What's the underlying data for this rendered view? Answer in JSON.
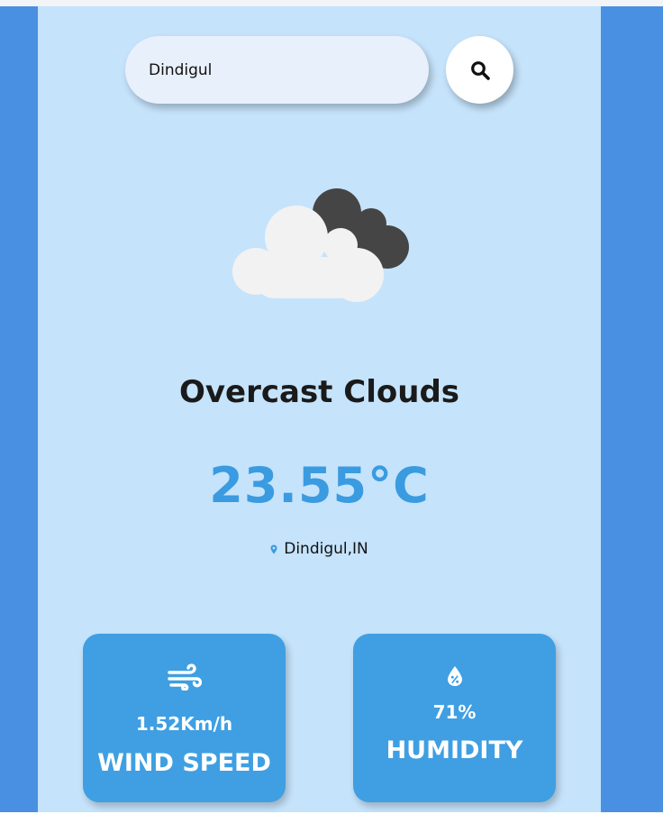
{
  "search": {
    "value": "Dindigul",
    "button_icon": "search-icon"
  },
  "weather": {
    "icon": "overcast-clouds-icon",
    "condition": "Overcast Clouds",
    "temperature": "23.55°C",
    "location": "Dindigul,IN",
    "location_icon": "map-pin-icon"
  },
  "cards": {
    "wind": {
      "icon": "wind-icon",
      "value": "1.52Km/h",
      "label": "WIND SPEED"
    },
    "humidity": {
      "icon": "humidity-icon",
      "value": "71%",
      "label": "HUMIDITY"
    }
  },
  "colors": {
    "background": "#4a90e2",
    "panel": "#c5e3fb",
    "accent": "#3f9fe2",
    "temperature": "#3a9be0"
  }
}
